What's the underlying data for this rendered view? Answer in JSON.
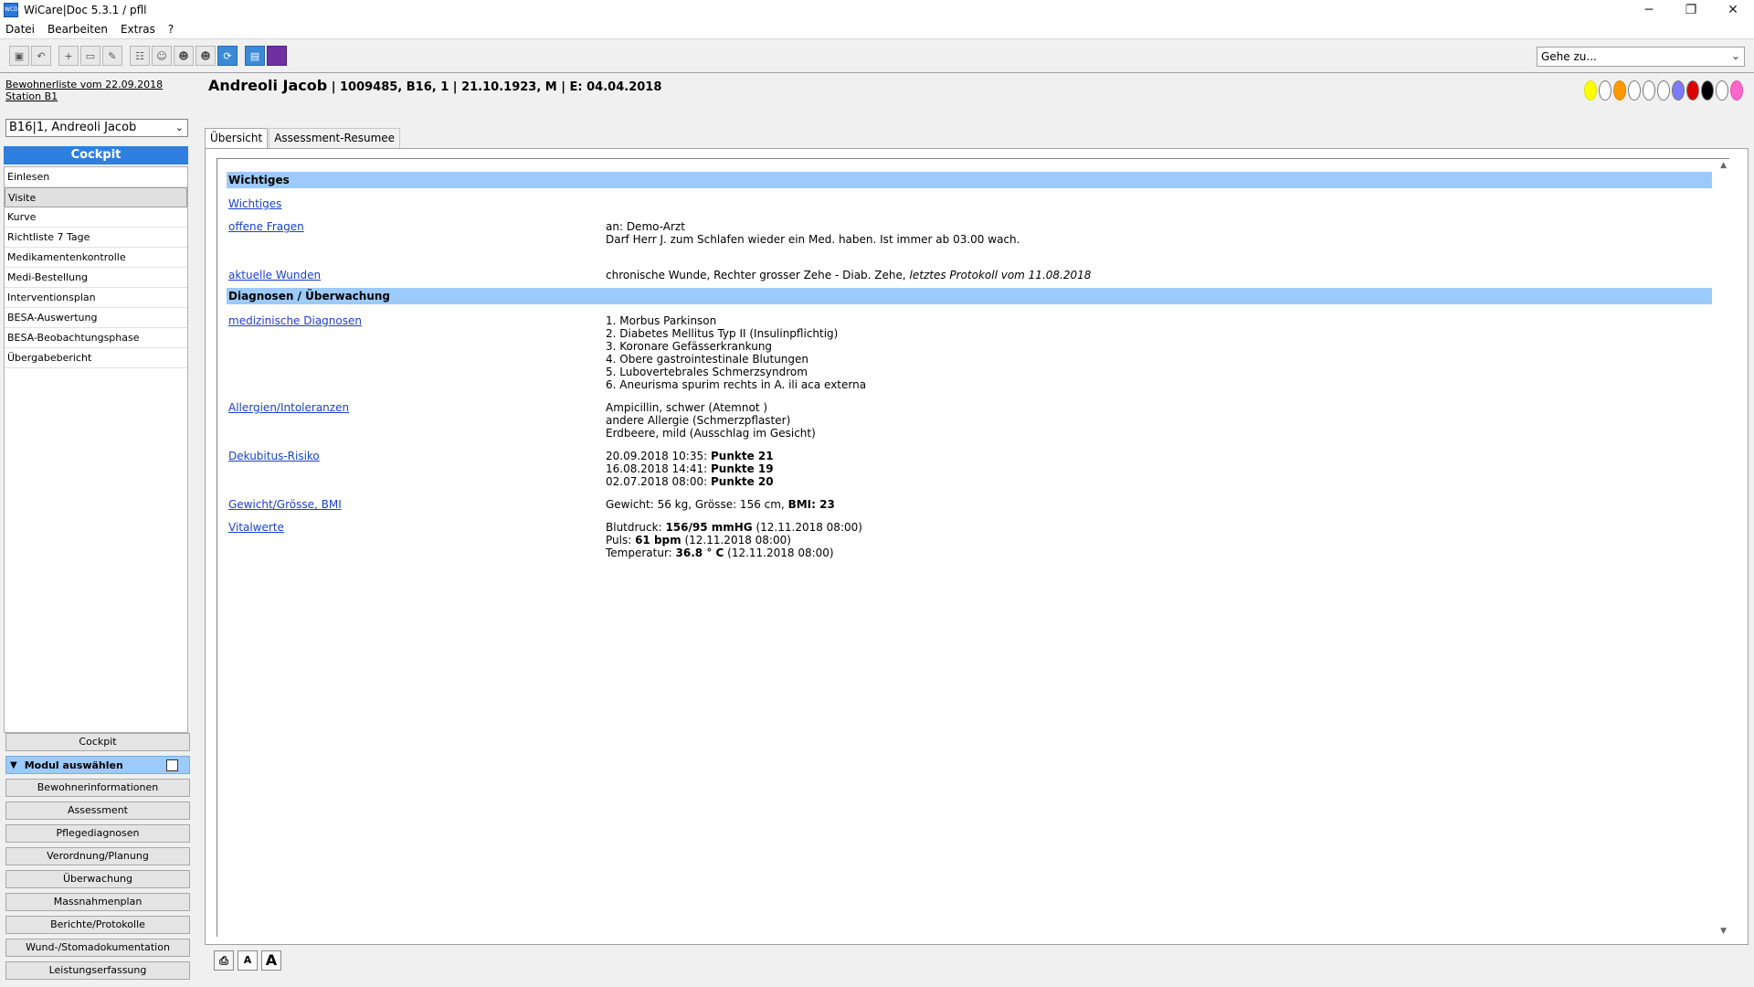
{
  "window": {
    "title": "WiCare|Doc 5.3.1  / pfll",
    "icon_text": "WCD",
    "minimize": "─",
    "restore": "❐",
    "close": "✕"
  },
  "menu": [
    "Datei",
    "Bearbeiten",
    "Extras",
    "?"
  ],
  "toolbar": {
    "goto_placeholder": "Gehe zu..."
  },
  "sidebar": {
    "resident_list_line1": "Bewohnerliste vom 22.09.2018",
    "resident_list_line2": "Station B1",
    "resident_selected": "B16|1, Andreoli Jacob",
    "cockpit_header": "Cockpit",
    "nav": [
      "Einlesen",
      "Visite",
      "Kurve",
      "Richtliste 7 Tage",
      "Medikamentenkontrolle",
      "Medi-Bestellung",
      "Interventionsplan",
      "BESA-Auswertung",
      "BESA-Beobachtungsphase",
      "Übergabebericht"
    ],
    "cockpit_button": "Cockpit",
    "modul_label": "Modul auswählen",
    "modules": [
      "Bewohnerinformationen",
      "Assessment",
      "Pflegediagnosen",
      "Verordnung/Planung",
      "Überwachung",
      "Massnahmenplan",
      "Berichte/Protokolle",
      "Wund-/Stomadokumentation",
      "Leistungserfassung"
    ]
  },
  "patient": {
    "name": "Andreoli Jacob",
    "details": "| 1009485, B16, 1 | 21.10.1923, M | E: 04.04.2018",
    "color_dots": [
      "#ffff00",
      "#ffffff",
      "#ff9900",
      "#ffffff",
      "#ffffff",
      "#ffffff",
      "#7b7bff",
      "#dd0000",
      "#000000",
      "#ffffff",
      "#ff66cc"
    ]
  },
  "tabs": [
    "Übersicht",
    "Assessment-Resumee"
  ],
  "overview": {
    "sec1": "Wichtiges",
    "wichtiges_link": "Wichtiges",
    "fragen_link": "offene Fragen",
    "fragen_to": "an: Demo-Arzt",
    "fragen_text": "Darf Herr J. zum Schlafen wieder ein Med. haben. Ist immer ab 03.00  wach.",
    "wunden_link": "aktuelle Wunden",
    "wunden_text": "chronische Wunde, Rechter grosser Zehe  - Diab. Zehe, ",
    "wunden_italic": "letztes Protokoll vom 11.08.2018",
    "sec2": "Diagnosen / Überwachung",
    "diag_link": "medizinische Diagnosen",
    "diagnoses": [
      "1. Morbus Parkinson",
      "2. Diabetes Mellitus Typ II (Insulinpflichtig)",
      "3. Koronare Gefässerkrankung",
      "4. Obere gastrointestinale Blutungen",
      "5. Lubovertebrales Schmerzsyndrom",
      "6. Aneurisma spurim rechts in A. ili aca externa"
    ],
    "allerg_link": "Allergien/Intoleranzen",
    "allergies": [
      "Ampicillin, schwer (Atemnot )",
      "andere Allergie (Schmerzpflaster)",
      "Erdbeere, mild (Ausschlag im Gesicht)"
    ],
    "dekub_link": "Dekubitus-Risiko",
    "dekub": [
      {
        "date": "20.09.2018 10:35:",
        "score": "Punkte 21"
      },
      {
        "date": "16.08.2018 14:41:",
        "score": "Punkte 19"
      },
      {
        "date": "02.07.2018 08:00:",
        "score": "Punkte 20"
      }
    ],
    "gewicht_link": "Gewicht/Grösse, BMI",
    "gewicht_text": "Gewicht: 56 kg, Grösse: 156 cm, ",
    "gewicht_bmi": "BMI: 23",
    "vital_link": "Vitalwerte",
    "vitals": [
      {
        "label": "Blutdruck: ",
        "value": "156/95 mmHG",
        "time": " (12.11.2018 08:00)"
      },
      {
        "label": "Puls: ",
        "value": "61 bpm",
        "time": " (12.11.2018 08:00)"
      },
      {
        "label": "Temperatur: ",
        "value": "36.8 ° C",
        "time": " (12.11.2018 08:00)"
      }
    ]
  },
  "bottom": {
    "small_a": "A",
    "big_a": "A"
  }
}
